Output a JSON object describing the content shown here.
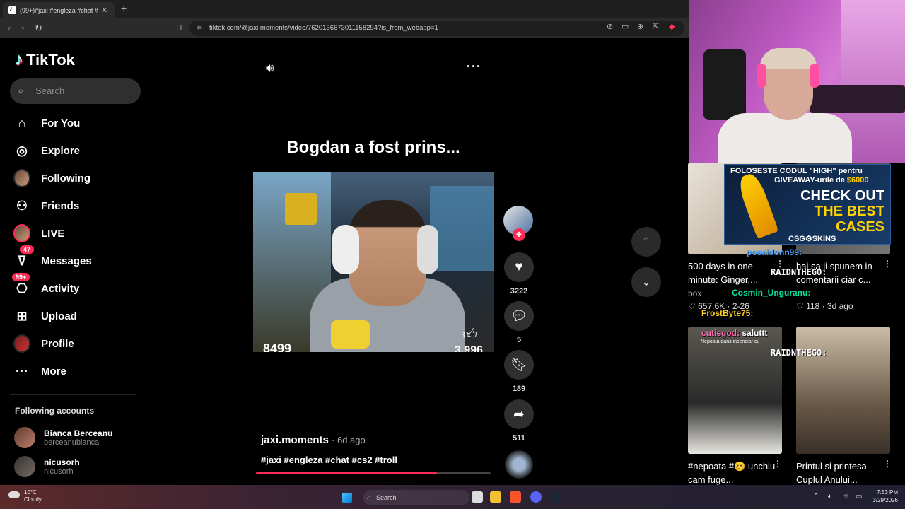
{
  "browser": {
    "tab_title": "(99+)#jaxi #engleza #chat #c...",
    "tab_close": "✕",
    "new_tab": "+",
    "url": "tiktok.com/@jaxi.moments/video/7620136673011158294?is_from_webapp=1"
  },
  "sidebar": {
    "logo_text": "TikTok",
    "search_placeholder": "Search",
    "items": [
      {
        "label": "For You",
        "icon": "home-icon"
      },
      {
        "label": "Explore",
        "icon": "compass-icon"
      },
      {
        "label": "Following",
        "icon": "avatar"
      },
      {
        "label": "Friends",
        "icon": "friends-icon"
      },
      {
        "label": "LIVE",
        "icon": "avatar"
      },
      {
        "label": "Messages",
        "icon": "send-icon",
        "badge": "47"
      },
      {
        "label": "Activity",
        "icon": "inbox-icon",
        "badge": "99+"
      },
      {
        "label": "Upload",
        "icon": "plus-square-icon"
      },
      {
        "label": "Profile",
        "icon": "avatar"
      },
      {
        "label": "More",
        "icon": "ellipsis-icon"
      }
    ],
    "following_title": "Following accounts",
    "following": [
      {
        "name": "Bianca Berceanu",
        "username": "berceanubianca"
      },
      {
        "name": "nicusorh",
        "username": "nicusorh"
      }
    ]
  },
  "video": {
    "caption_overlay": "Bogdan a fost prins...",
    "overlay_left_number": "8499",
    "overlay_right_number": "3,996",
    "author": "jaxi.moments",
    "time_ago": "· 6d ago",
    "hashtags": "#jaxi #engleza #chat #cs2 #troll",
    "progress": 0.77
  },
  "actions": {
    "likes": "3222",
    "comments": "5",
    "saves": "189",
    "shares": "511"
  },
  "stream": {
    "promo_line1": "FOLOSESTE CODUL \"HIGH\" pentru",
    "promo_line2_a": "GIVEAWAY-urile de ",
    "promo_line2_b": "$6000",
    "promo_big1": "CHECK OUT",
    "promo_big2": "THE BEST",
    "promo_big3": "CASES",
    "promo_brand": "CSG⚙SKINS",
    "chat": [
      {
        "user": "posaidonn99:",
        "color": "#4aa3ff"
      },
      {
        "user": "RAIDNTHEGO:",
        "color": "#ffffff"
      },
      {
        "user": "Cosmin_Unguranu:",
        "color": "#00e5a0"
      },
      {
        "user": "FrostByte75:",
        "color": "#ffd21f"
      },
      {
        "user": "cutiegod:",
        "message": "saluttt",
        "color": "#ff69b4"
      },
      {
        "user": "RAIDNTHEGO:",
        "color": "#ffffff"
      }
    ]
  },
  "grid": [
    {
      "title": "500 days in one minute: Ginger,...",
      "extra": "box",
      "likes": "657.6K",
      "date": "2-26"
    },
    {
      "title": "hai sa ji spunem in comentarii ciar c...",
      "likes": "118",
      "date": "3d ago"
    },
    {
      "title": "#nepoata #🥴 unchiu cam fuge...",
      "thumb_text": "Nepoata dans incendiar cu"
    },
    {
      "title": "Printul si printesa Cuplul Anului..."
    }
  ],
  "taskbar": {
    "temp": "10°C",
    "weather": "Cloudy",
    "search": "Search",
    "time": "7:53 PM",
    "date": "3/29/2026"
  },
  "colors": {
    "accent": "#fe2c55",
    "bg": "#000000",
    "surface": "#2f2f2f"
  }
}
